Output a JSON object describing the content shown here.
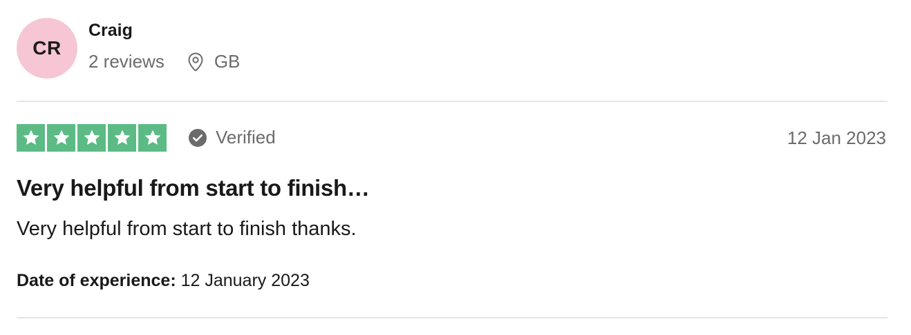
{
  "reviewer": {
    "initials": "CR",
    "avatar_color": "#f6c6d4",
    "name": "Craig",
    "reviews_count": "2 reviews",
    "location": "GB",
    "location_icon": "map-pin-icon"
  },
  "review": {
    "rating": 5,
    "max_rating": 5,
    "star_color": "#5cbb85",
    "verified_label": "Verified",
    "verified_icon": "check-circle-icon",
    "date": "12 Jan 2023",
    "title": "Very helpful from start to finish…",
    "body": "Very helpful from start to finish thanks.",
    "experience_label": "Date of experience:",
    "experience_date": "12 January 2023"
  }
}
